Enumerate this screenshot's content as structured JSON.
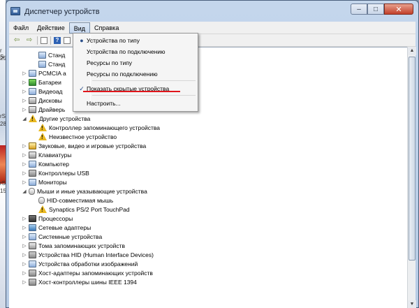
{
  "desktop": {
    "snippets": [
      "r S",
      "25",
      "rS",
      "28",
      "rS",
      "15"
    ]
  },
  "window": {
    "title": "Диспетчер устройств",
    "controls": {
      "minimize": "–",
      "maximize": "□",
      "close": "✕"
    }
  },
  "menubar": [
    "Файл",
    "Действие",
    "Вид",
    "Справка"
  ],
  "toolbar": {
    "back": "⇦",
    "forward": "⇨",
    "help": "?"
  },
  "tree": [
    {
      "arrow": "",
      "icon": "device",
      "label": "Станд"
    },
    {
      "arrow": "",
      "icon": "device",
      "label": "Станд"
    },
    {
      "arrow": "▷",
      "icon": "device",
      "label": "PCMCIA а"
    },
    {
      "arrow": "▷",
      "icon": "bat",
      "label": "Батареи"
    },
    {
      "arrow": "▷",
      "icon": "device",
      "label": "Видеоад"
    },
    {
      "arrow": "▷",
      "icon": "storage",
      "label": "Дисковы"
    },
    {
      "arrow": "▷",
      "icon": "storage",
      "label": "Драйверь"
    },
    {
      "arrow": "◢",
      "icon": "warn",
      "label": "Другие устройства"
    },
    {
      "arrow": "",
      "icon": "warn",
      "label": "Контроллер запоминающего устройства"
    },
    {
      "arrow": "",
      "icon": "warn",
      "label": "Неизвестное устройство"
    },
    {
      "arrow": "▷",
      "icon": "snd",
      "label": "Звуковые, видео и игровые устройства"
    },
    {
      "arrow": "▷",
      "icon": "storage",
      "label": "Клавиатуры"
    },
    {
      "arrow": "▷",
      "icon": "device",
      "label": "Компьютер"
    },
    {
      "arrow": "▷",
      "icon": "usb",
      "label": "Контроллеры USB"
    },
    {
      "arrow": "▷",
      "icon": "device",
      "label": "Мониторы"
    },
    {
      "arrow": "◢",
      "icon": "mouse",
      "label": "Мыши и иные указывающие устройства"
    },
    {
      "arrow": "",
      "icon": "mouse",
      "label": "HID-совместимая мышь"
    },
    {
      "arrow": "",
      "icon": "warn",
      "label": "Synaptics PS/2 Port TouchPad"
    },
    {
      "arrow": "▷",
      "icon": "cpu",
      "label": "Процессоры"
    },
    {
      "arrow": "▷",
      "icon": "net",
      "label": "Сетевые адаптеры"
    },
    {
      "arrow": "▷",
      "icon": "device",
      "label": "Системные устройства"
    },
    {
      "arrow": "▷",
      "icon": "storage",
      "label": "Тома запоминающих устройств"
    },
    {
      "arrow": "▷",
      "icon": "usb",
      "label": "Устройства HID (Human Interface Devices)"
    },
    {
      "arrow": "▷",
      "icon": "device",
      "label": "Устройства обработки изображений"
    },
    {
      "arrow": "▷",
      "icon": "usb",
      "label": "Хост-адаптеры запоминающих устройств"
    },
    {
      "arrow": "▷",
      "icon": "usb",
      "label": "Хост-контроллеры шины IEEE 1394"
    }
  ],
  "view_menu": {
    "items": [
      {
        "label": "Устройства по типу",
        "mark": "●"
      },
      {
        "label": "Устройства по подключению",
        "mark": ""
      },
      {
        "label": "Ресурсы по типу",
        "mark": ""
      },
      {
        "label": "Ресурсы по подключению",
        "mark": ""
      },
      {
        "label": "Показать скрытые устройства",
        "mark": "✓"
      },
      {
        "label": "Настроить...",
        "mark": ""
      }
    ],
    "highlight_color": "#e0151b"
  }
}
